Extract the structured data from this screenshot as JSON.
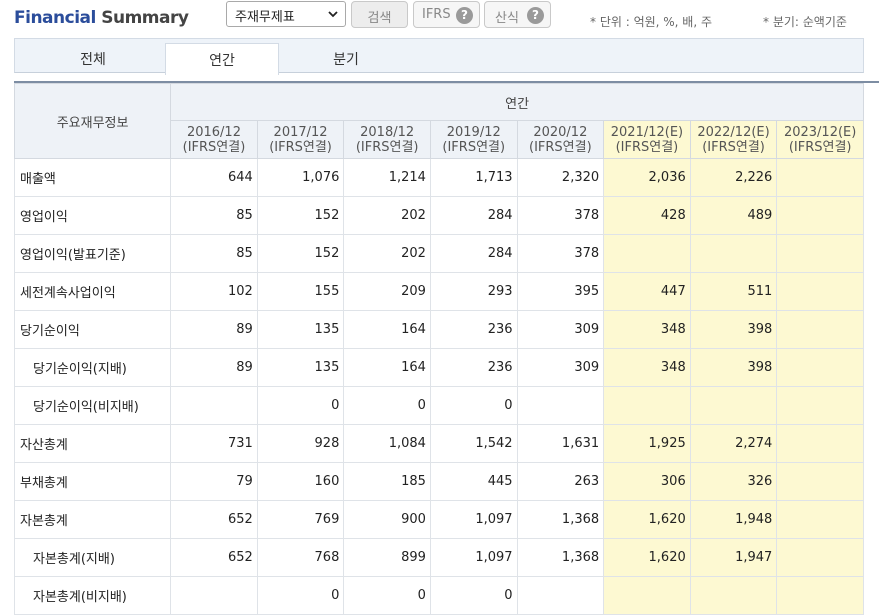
{
  "header": {
    "title_brand": "Financial",
    "title_rest": " Summary",
    "select_value": "주재무제표",
    "search_label": "검색",
    "ifrs_label": "IFRS",
    "calc_label": "산식",
    "help_glyph": "?",
    "unit_note": "* 단위 : 억원, %, 배, 주",
    "period_note": "* 분기: 순액기준"
  },
  "tabs": [
    {
      "label": "전체"
    },
    {
      "label": "연간",
      "selected": true
    },
    {
      "label": "분기"
    }
  ],
  "table": {
    "label_header": "주요재무정보",
    "group_header": "연간",
    "columns": [
      {
        "period": "2016/12",
        "basis": "(IFRS연결)"
      },
      {
        "period": "2017/12",
        "basis": "(IFRS연결)"
      },
      {
        "period": "2018/12",
        "basis": "(IFRS연결)"
      },
      {
        "period": "2019/12",
        "basis": "(IFRS연결)"
      },
      {
        "period": "2020/12",
        "basis": "(IFRS연결)"
      },
      {
        "period": "2021/12(E)",
        "basis": "(IFRS연결)",
        "estimate": true
      },
      {
        "period": "2022/12(E)",
        "basis": "(IFRS연결)",
        "estimate": true
      },
      {
        "period": "2023/12(E)",
        "basis": "(IFRS연결)",
        "estimate": true
      }
    ],
    "rows": [
      {
        "label": "매출액",
        "indent": false,
        "values": [
          "644",
          "1,076",
          "1,214",
          "1,713",
          "2,320",
          "2,036",
          "2,226",
          ""
        ]
      },
      {
        "label": "영업이익",
        "indent": false,
        "values": [
          "85",
          "152",
          "202",
          "284",
          "378",
          "428",
          "489",
          ""
        ]
      },
      {
        "label": "영업이익(발표기준)",
        "indent": false,
        "values": [
          "85",
          "152",
          "202",
          "284",
          "378",
          "",
          "",
          ""
        ]
      },
      {
        "label": "세전계속사업이익",
        "indent": false,
        "values": [
          "102",
          "155",
          "209",
          "293",
          "395",
          "447",
          "511",
          ""
        ]
      },
      {
        "label": "당기순이익",
        "indent": false,
        "values": [
          "89",
          "135",
          "164",
          "236",
          "309",
          "348",
          "398",
          ""
        ]
      },
      {
        "label": "당기순이익(지배)",
        "indent": true,
        "values": [
          "89",
          "135",
          "164",
          "236",
          "309",
          "348",
          "398",
          ""
        ]
      },
      {
        "label": "당기순이익(비지배)",
        "indent": true,
        "values": [
          "",
          "0",
          "0",
          "0",
          "",
          "",
          "",
          ""
        ]
      },
      {
        "label": "자산총계",
        "indent": false,
        "values": [
          "731",
          "928",
          "1,084",
          "1,542",
          "1,631",
          "1,925",
          "2,274",
          ""
        ]
      },
      {
        "label": "부채총계",
        "indent": false,
        "values": [
          "79",
          "160",
          "185",
          "445",
          "263",
          "306",
          "326",
          ""
        ]
      },
      {
        "label": "자본총계",
        "indent": false,
        "values": [
          "652",
          "769",
          "900",
          "1,097",
          "1,368",
          "1,620",
          "1,948",
          ""
        ]
      },
      {
        "label": "자본총계(지배)",
        "indent": true,
        "values": [
          "652",
          "768",
          "899",
          "1,097",
          "1,368",
          "1,620",
          "1,947",
          ""
        ]
      },
      {
        "label": "자본총계(비지배)",
        "indent": true,
        "values": [
          "",
          "0",
          "0",
          "0",
          "",
          "",
          "",
          ""
        ]
      }
    ]
  },
  "colors": {
    "brand_blue": "#2b4d9b",
    "estimate_bg": "#fdf9d2",
    "header_bg": "#eef2f7"
  }
}
